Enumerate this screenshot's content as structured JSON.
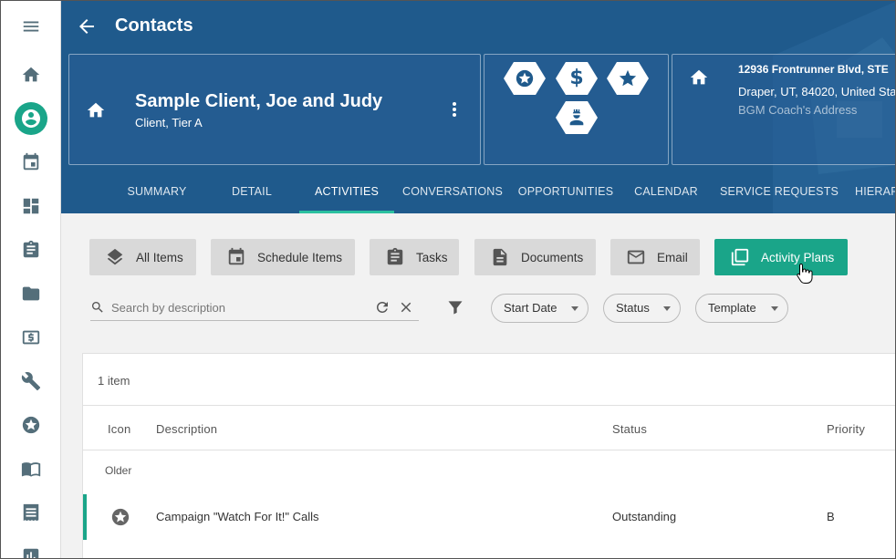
{
  "app": {
    "page_title": "Contacts"
  },
  "rail": {
    "items": [
      {
        "icon": "menu-icon"
      },
      {
        "icon": "home-icon"
      },
      {
        "icon": "contact-icon",
        "active": true
      },
      {
        "icon": "calendar-icon"
      },
      {
        "icon": "dashboard-icon"
      },
      {
        "icon": "clipboard-icon"
      },
      {
        "icon": "folder-icon"
      },
      {
        "icon": "money-icon"
      },
      {
        "icon": "wrench-icon"
      },
      {
        "icon": "star-icon"
      },
      {
        "icon": "book-icon"
      },
      {
        "icon": "receipt-icon"
      },
      {
        "icon": "chart-icon"
      }
    ]
  },
  "client": {
    "name": "Sample Client, Joe and Judy",
    "subtitle": "Client, Tier A"
  },
  "badges": [
    "star-circle-icon",
    "dollar-icon",
    "star-icon",
    "worker-icon"
  ],
  "address": {
    "line1": "12936 Frontrunner Blvd, STE",
    "line2": "Draper, UT, 84020, United Sta",
    "line3": "BGM Coach's Address"
  },
  "tabs": [
    {
      "label": "SUMMARY"
    },
    {
      "label": "DETAIL"
    },
    {
      "label": "ACTIVITIES",
      "active": true
    },
    {
      "label": "CONVERSATIONS"
    },
    {
      "label": "OPPORTUNITIES"
    },
    {
      "label": "CALENDAR"
    },
    {
      "label": "SERVICE REQUESTS"
    },
    {
      "label": "HIERAR"
    }
  ],
  "toolbar": {
    "all_items": "All Items",
    "schedule_items": "Schedule Items",
    "tasks": "Tasks",
    "documents": "Documents",
    "email": "Email",
    "activity_plans": "Activity Plans"
  },
  "filters": {
    "search_placeholder": "Search by description",
    "start_date": "Start Date",
    "status": "Status",
    "template": "Template"
  },
  "table": {
    "count": "1 item",
    "columns": {
      "icon": "Icon",
      "description": "Description",
      "status": "Status",
      "priority": "Priority"
    },
    "group_label": "Older",
    "rows": [
      {
        "icon": "star-circle-icon",
        "description": "Campaign \"Watch For It!\" Calls",
        "status": "Outstanding",
        "priority": "B"
      }
    ]
  },
  "colors": {
    "header_blue": "#1f5a8c",
    "accent_green": "#1aa589"
  }
}
